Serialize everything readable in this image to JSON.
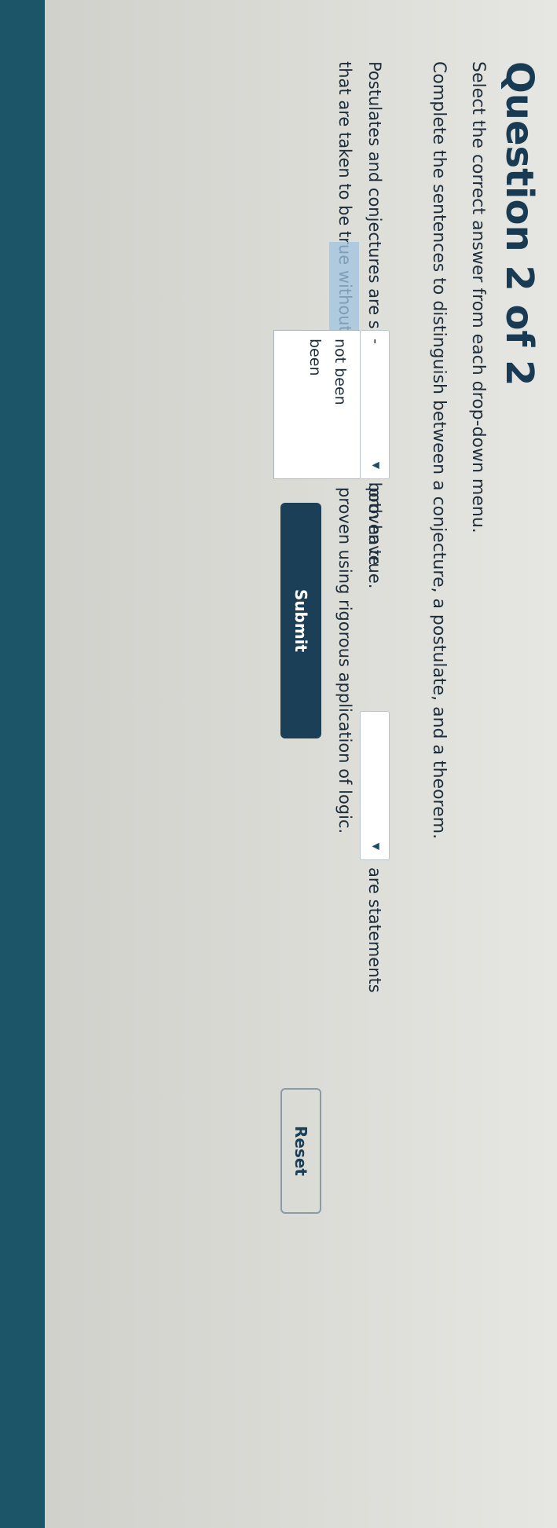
{
  "page": {
    "title": "Question 2 of 2",
    "instruction": "Select the correct answer from each drop-down menu.",
    "prompt": "Complete the sentences to distinguish between a conjecture, a postulate, and a theorem."
  },
  "sentence": {
    "line1_before": "Postulates and conjectures are similar in that they both have",
    "line1_mid": "proven true.",
    "line1_after": "are statements",
    "line2_before": "that are taken to be true without requiring proof.",
    "line2_after": "proven using rigorous application of logic."
  },
  "dropdown1": {
    "selected": "-",
    "options": [
      "not been",
      "been"
    ],
    "open": true
  },
  "dropdown2": {
    "selected": "",
    "open": false
  },
  "buttons": {
    "submit_label": "Submit",
    "reset_label": "Reset"
  },
  "colors": {
    "primary": "#1b3f57",
    "highlight": "#9fc3e0",
    "edge_strip": "#1c5468"
  }
}
